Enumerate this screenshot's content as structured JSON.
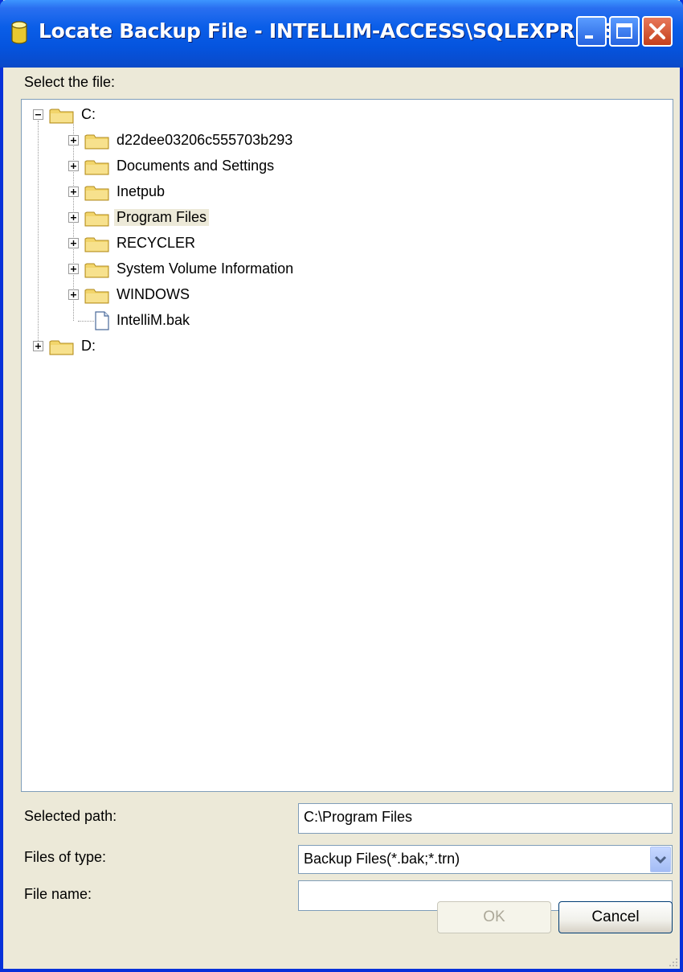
{
  "window": {
    "title": "Locate Backup File - INTELLIM-ACCESS\\SQLEXPRESS"
  },
  "tree_label": "Select the file:",
  "tree": {
    "root_c": "C:",
    "c_children": [
      {
        "label": "d22dee03206c555703b293",
        "type": "folder"
      },
      {
        "label": "Documents and Settings",
        "type": "folder"
      },
      {
        "label": "Inetpub",
        "type": "folder"
      },
      {
        "label": "Program Files",
        "type": "folder",
        "selected": true
      },
      {
        "label": "RECYCLER",
        "type": "folder"
      },
      {
        "label": "System Volume Information",
        "type": "folder"
      },
      {
        "label": "WINDOWS",
        "type": "folder"
      },
      {
        "label": "IntelliM.bak",
        "type": "file"
      }
    ],
    "root_d": "D:"
  },
  "form": {
    "selected_path_label": "Selected path:",
    "selected_path_value": "C:\\Program Files",
    "files_of_type_label": "Files of type:",
    "files_of_type_value": "Backup Files(*.bak;*.trn)",
    "file_name_label": "File name:",
    "file_name_value": ""
  },
  "buttons": {
    "ok": "OK",
    "cancel": "Cancel"
  }
}
